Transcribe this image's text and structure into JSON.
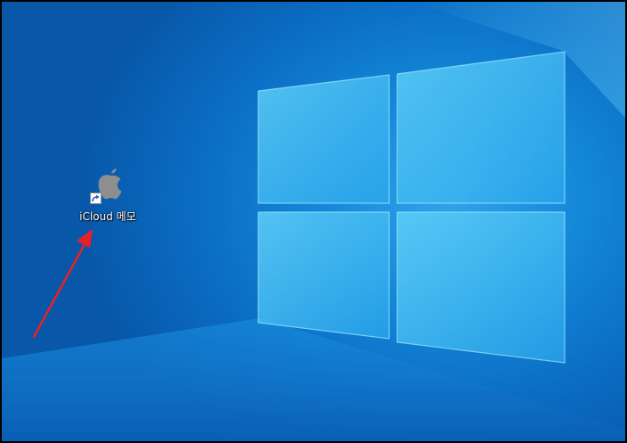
{
  "desktop": {
    "icons": [
      {
        "label": "iCloud 메모",
        "icon": "apple-icon",
        "shortcut": true
      }
    ]
  },
  "colors": {
    "wallpaper_dark": "#0857a8",
    "wallpaper_light": "#2fa3ea",
    "window_pane": "#56c6f5",
    "annotation_arrow": "#e8202a"
  }
}
